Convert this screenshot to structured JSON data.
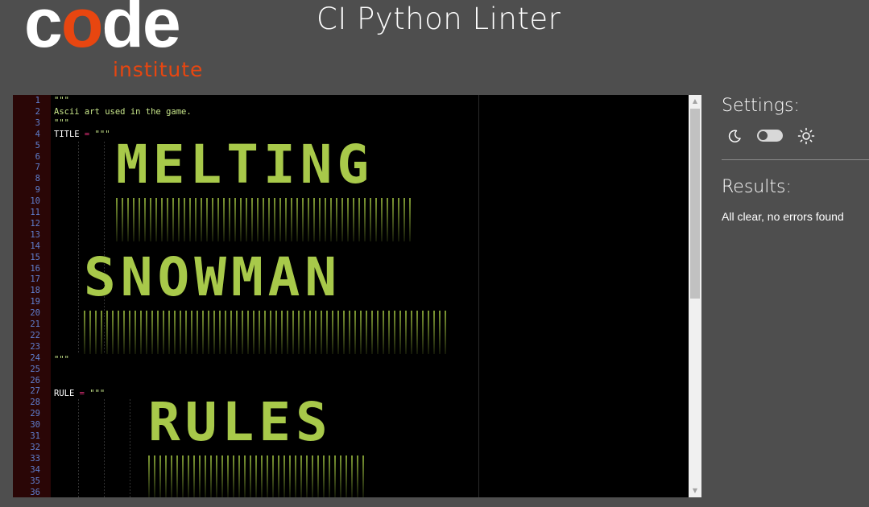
{
  "logo": {
    "word_c": "c",
    "word_o": "o",
    "word_de": "de",
    "subtitle": "institute"
  },
  "header": {
    "title": "CI Python Linter"
  },
  "editor": {
    "line_numbers": [
      "1",
      "2",
      "3",
      "4",
      "5",
      "6",
      "7",
      "8",
      "9",
      "10",
      "11",
      "12",
      "13",
      "14",
      "15",
      "16",
      "17",
      "18",
      "19",
      "20",
      "21",
      "22",
      "23",
      "24",
      "25",
      "26",
      "27",
      "28",
      "29",
      "30",
      "31",
      "32",
      "33",
      "34",
      "35",
      "36"
    ],
    "lines": {
      "l1": "\"\"\"",
      "l2": "Ascii art used in the game.",
      "l3": "\"\"\"",
      "l4_ident": "TITLE",
      "l4_op": " = ",
      "l4_str": "\"\"\"",
      "l24": "\"\"\"",
      "l27_ident": "RULE",
      "l27_op": " = ",
      "l27_str": "\"\"\""
    },
    "ascii_art": {
      "word1": "MELTING",
      "word2": "SNOWMAN",
      "word3": "RULES"
    },
    "accent_colors": {
      "string": "#c8e68a",
      "operator": "#e5307a",
      "line_number": "#5f7fcf",
      "art": "#a8c94a"
    }
  },
  "settings": {
    "title": "Settings:",
    "dark_icon": "moon-icon",
    "light_icon": "sun-icon"
  },
  "results": {
    "title": "Results:",
    "message": "All clear, no errors found"
  }
}
